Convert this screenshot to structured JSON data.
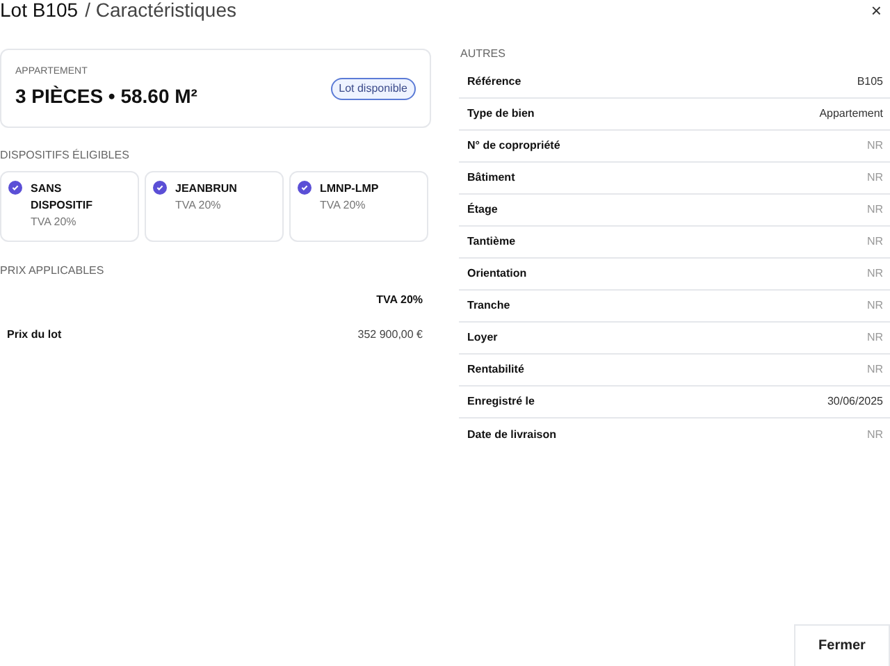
{
  "header": {
    "title": "Lot B105",
    "subtitle": "/ Caractéristiques",
    "close": "×"
  },
  "lot_card": {
    "category": "APPARTEMENT",
    "summary": "3 PIÈCES • 58.60 M²",
    "status": "Lot disponible"
  },
  "dispositifs": {
    "heading": "DISPOSITIFS ÉLIGIBLES",
    "items": [
      {
        "name": "SANS DISPOSITIF",
        "tva": "TVA 20%",
        "checked": true
      },
      {
        "name": "JEANBRUN",
        "tva": "TVA 20%",
        "checked": true
      },
      {
        "name": "LMNP-LMP",
        "tva": "TVA 20%",
        "checked": true
      }
    ]
  },
  "prix": {
    "heading": "PRIX APPLICABLES",
    "column": "TVA 20%",
    "rows": [
      {
        "label": "Prix du lot",
        "value": "352 900,00 €"
      }
    ]
  },
  "autres": {
    "heading": "AUTRES",
    "rows": [
      {
        "label": "Référence",
        "value": "B105",
        "muted": false
      },
      {
        "label": "Type de bien",
        "value": "Appartement",
        "muted": false
      },
      {
        "label": "N° de copropriété",
        "value": "NR",
        "muted": true
      },
      {
        "label": "Bâtiment",
        "value": "NR",
        "muted": true
      },
      {
        "label": "Étage",
        "value": "NR",
        "muted": true
      },
      {
        "label": "Tantième",
        "value": "NR",
        "muted": true
      },
      {
        "label": "Orientation",
        "value": "NR",
        "muted": true
      },
      {
        "label": "Tranche",
        "value": "NR",
        "muted": true
      },
      {
        "label": "Loyer",
        "value": "NR",
        "muted": true
      },
      {
        "label": "Rentabilité",
        "value": "NR",
        "muted": true
      },
      {
        "label": "Enregistré le",
        "value": "30/06/2025",
        "muted": false
      },
      {
        "label": "Date de livraison",
        "value": "NR",
        "muted": true
      }
    ]
  },
  "footer": {
    "button": "Fermer"
  }
}
